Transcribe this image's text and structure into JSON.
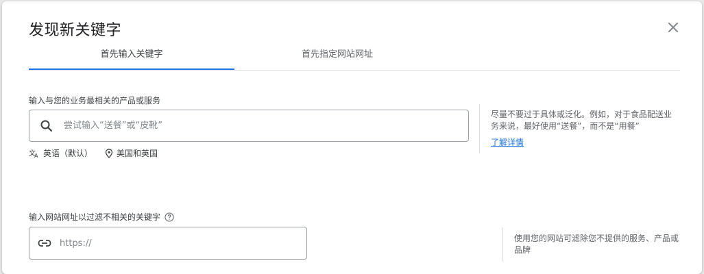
{
  "dialog": {
    "title": "发现新关键字",
    "tabs": [
      {
        "label": "首先输入关键字",
        "active": true
      },
      {
        "label": "首先指定网站网址",
        "active": false
      }
    ]
  },
  "keywords_section": {
    "label": "输入与您的业务最相关的产品或服务",
    "search_placeholder": "尝试输入“送餐”或“皮靴”",
    "language": "英语（默认）",
    "location": "美国和英国",
    "tip": "尽量不要过于具体或泛化。例如，对于食品配送业务来说，最好使用“送餐”，而不是“用餐”",
    "learn_more": "了解详情"
  },
  "website_section": {
    "label": "输入网站网址以过滤不相关的关键字",
    "url_placeholder": "https://",
    "tip": "使用您的网站可滤除您不提供的服务、产品或品牌"
  },
  "icons": {
    "close": "close-icon",
    "search": "search-icon",
    "language": "translate-icon",
    "location": "location-pin-icon",
    "help": "help-circle-icon",
    "link": "link-icon"
  },
  "colors": {
    "accent": "#1a73e8",
    "text": "#3c4043",
    "muted": "#5f6368",
    "border": "#9aa0a6"
  }
}
